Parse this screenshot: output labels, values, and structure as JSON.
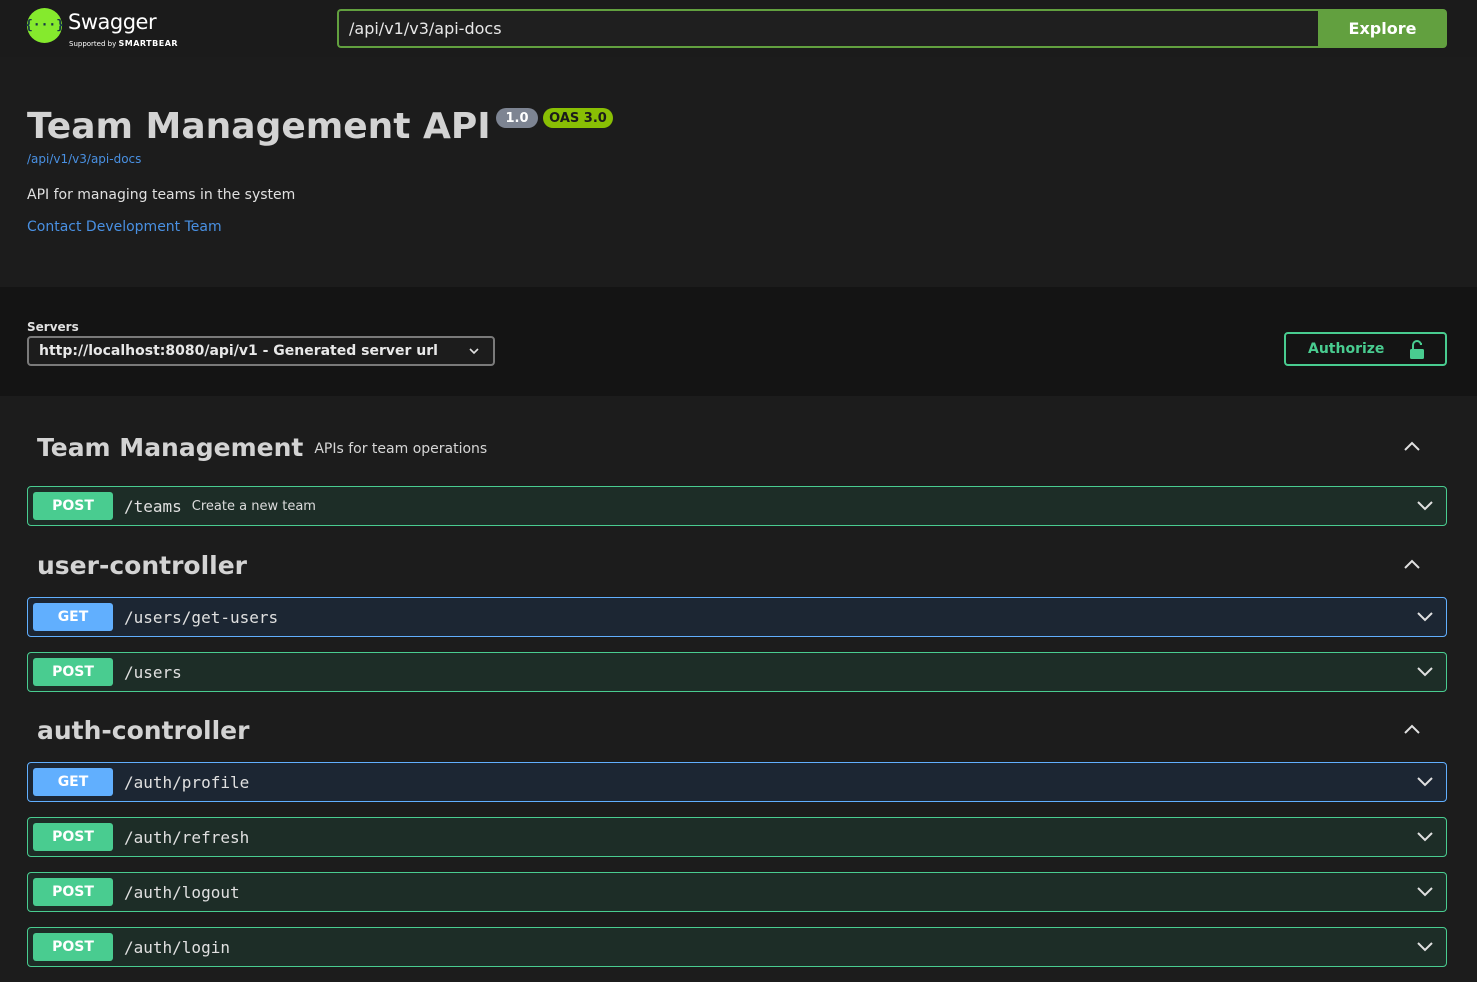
{
  "topbar": {
    "logo_word": "Swagger",
    "logo_sub_prefix": "Supported by",
    "logo_sub_brand": "SMARTBEAR",
    "url_value": "/api/v1/v3/api-docs",
    "explore_label": "Explore"
  },
  "info": {
    "title": "Team Management API",
    "version_badge": "1.0",
    "oas_badge": "OAS 3.0",
    "docs_link": "/api/v1/v3/api-docs",
    "description": "API for managing teams in the system",
    "contact_link": "Contact Development Team"
  },
  "servers": {
    "label": "Servers",
    "selected": "http://localhost:8080/api/v1 - Generated server url",
    "authorize_label": "Authorize"
  },
  "tags": [
    {
      "name": "Team Management",
      "description": "APIs for team operations",
      "operations": [
        {
          "method": "POST",
          "path": "/teams",
          "summary": "Create a new team"
        }
      ]
    },
    {
      "name": "user-controller",
      "description": "",
      "operations": [
        {
          "method": "GET",
          "path": "/users/get-users",
          "summary": ""
        },
        {
          "method": "POST",
          "path": "/users",
          "summary": ""
        }
      ]
    },
    {
      "name": "auth-controller",
      "description": "",
      "operations": [
        {
          "method": "GET",
          "path": "/auth/profile",
          "summary": ""
        },
        {
          "method": "POST",
          "path": "/auth/refresh",
          "summary": ""
        },
        {
          "method": "POST",
          "path": "/auth/logout",
          "summary": ""
        },
        {
          "method": "POST",
          "path": "/auth/login",
          "summary": ""
        }
      ]
    }
  ],
  "colors": {
    "post": "#49cc90",
    "get": "#61affe",
    "accent": "#62a03f"
  }
}
